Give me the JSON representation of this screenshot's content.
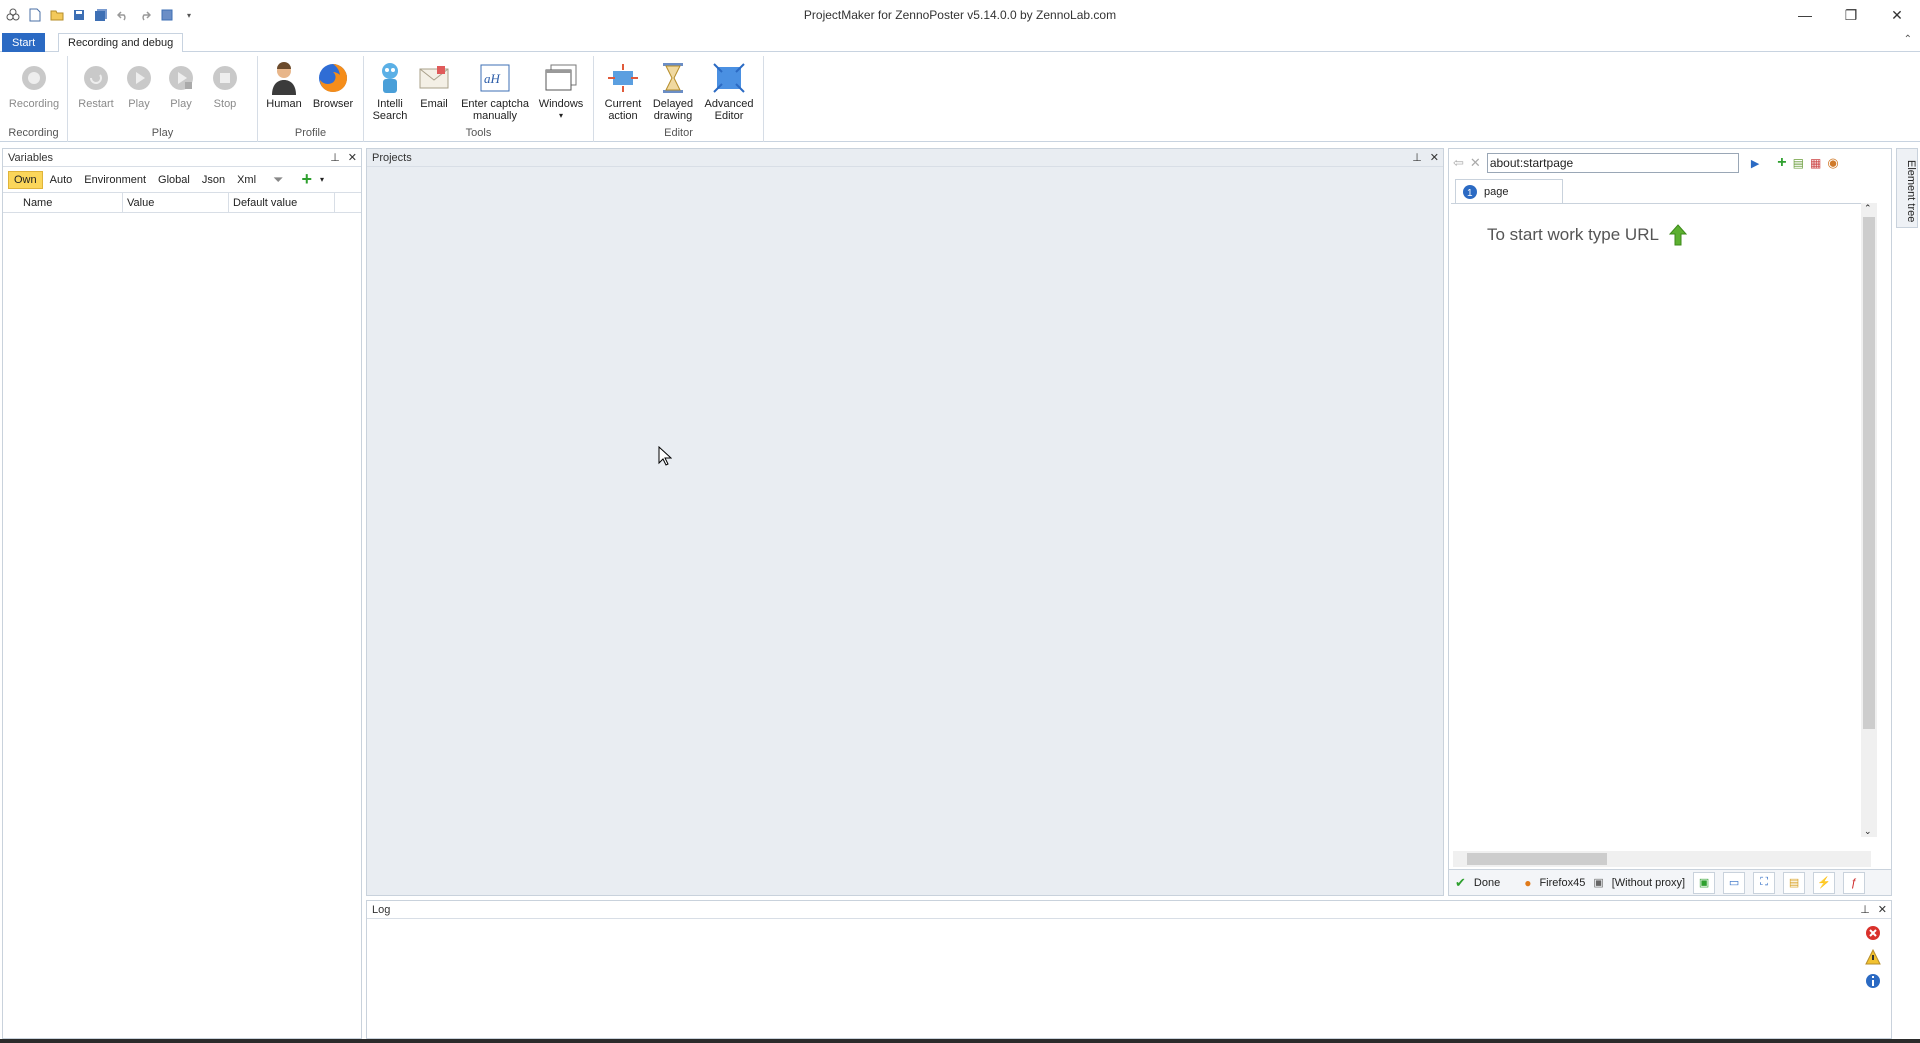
{
  "window": {
    "title": "ProjectMaker for ZennoPoster v5.14.0.0 by ZennoLab.com",
    "minimize": "—",
    "restore": "❐",
    "close": "✕"
  },
  "tabs": {
    "start": "Start",
    "recording": "Recording and debug"
  },
  "ribbon": {
    "recording": {
      "label": "Recording",
      "buttons": {
        "recording": "Recording"
      }
    },
    "play": {
      "label": "Play",
      "buttons": {
        "restart": "Restart",
        "play": "Play",
        "play_step": "Play",
        "stop": "Stop"
      }
    },
    "profile": {
      "label": "Profile",
      "buttons": {
        "human": "Human",
        "browser": "Browser"
      }
    },
    "tools": {
      "label": "Tools",
      "buttons": {
        "intelli": "Intelli\nSearch",
        "email": "Email",
        "captcha": "Enter captcha\nmanually",
        "windows": "Windows"
      }
    },
    "editor": {
      "label": "Editor",
      "buttons": {
        "current": "Current\naction",
        "delayed": "Delayed\ndrawing",
        "advanced": "Advanced\nEditor"
      }
    }
  },
  "variables": {
    "title": "Variables",
    "tabs": [
      "Own",
      "Auto",
      "Environment",
      "Global",
      "Json",
      "Xml"
    ],
    "columns": [
      "Name",
      "Value",
      "Default value"
    ]
  },
  "projects": {
    "title": "Projects"
  },
  "browser": {
    "url": "about:startpage",
    "page_tab": "page",
    "start_text": "To start work type URL",
    "status": "Done",
    "engine": "Firefox45",
    "proxy": "[Without proxy]"
  },
  "element_tree": {
    "label": "Element tree"
  },
  "log": {
    "title": "Log"
  }
}
